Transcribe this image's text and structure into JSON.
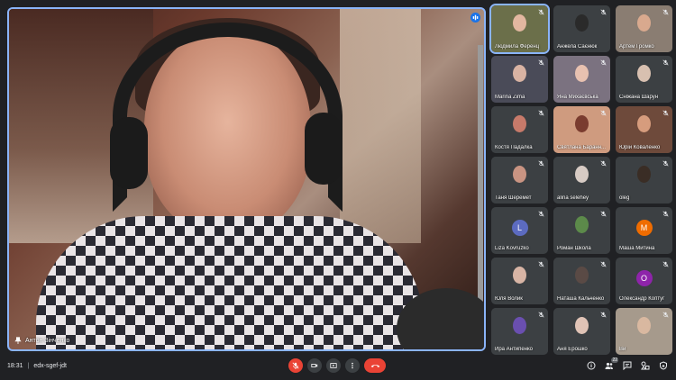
{
  "meeting": {
    "time": "18:31",
    "code": "edx-sgef-jdt"
  },
  "main_speaker": {
    "name": "Антон Зінченко"
  },
  "participants": [
    {
      "name": "Людмила Ференц",
      "type": "video",
      "bg": "#6b6f4a",
      "face": "#e2b7a0",
      "highlight": true
    },
    {
      "name": "Анжела Саєнюк",
      "type": "video",
      "bg": "#3c4043",
      "face": "#2a2a2a"
    },
    {
      "name": "Артем Громко",
      "type": "video",
      "bg": "#8a7d72",
      "face": "#d9a98e"
    },
    {
      "name": "Marina Zima",
      "type": "video",
      "bg": "#4a4b58",
      "face": "#d9b3a3"
    },
    {
      "name": "Яна Михаєвська",
      "type": "video",
      "bg": "#7b7280",
      "face": "#e8c1b0"
    },
    {
      "name": "Сніжана Шарун",
      "type": "video",
      "bg": "#3c4043",
      "face": "#d8c0b0"
    },
    {
      "name": "Костя Падалка",
      "type": "video",
      "bg": "#3c4043",
      "face": "#c77a6a"
    },
    {
      "name": "Святлана Баранн...",
      "type": "video",
      "bg": "#cf9b7f",
      "face": "#7a3c2f"
    },
    {
      "name": "Юрій Коваленко",
      "type": "video",
      "bg": "#6e4a3b",
      "face": "#d69c7d"
    },
    {
      "name": "Таня Шеремет",
      "type": "video",
      "bg": "#3c4043",
      "face": "#c99482"
    },
    {
      "name": "alina selehey",
      "type": "video",
      "bg": "#3c4043",
      "face": "#d7cbc4"
    },
    {
      "name": "oleg",
      "type": "video",
      "bg": "#3c4043",
      "face": "#3a2d25"
    },
    {
      "name": "Liza Kovruzko",
      "type": "avatar",
      "letter": "L",
      "avatar_color": "#5c6bc0"
    },
    {
      "name": "Роман Школа",
      "type": "video",
      "bg": "#3c4043",
      "face": "#5c8a4a"
    },
    {
      "name": "Маша Митина",
      "type": "avatar",
      "letter": "M",
      "avatar_color": "#ef6c00"
    },
    {
      "name": "Юля Волик",
      "type": "video",
      "bg": "#3c4043",
      "face": "#d8b5a5"
    },
    {
      "name": "Наташа Кальченко",
      "type": "video",
      "bg": "#3c4043",
      "face": "#5a4a45"
    },
    {
      "name": "Олександр Коптуг",
      "type": "avatar",
      "letter": "О",
      "avatar_color": "#8e24aa"
    },
    {
      "name": "Ира Антипенко",
      "type": "video",
      "bg": "#3c4043",
      "face": "#6a4fb0"
    },
    {
      "name": "Аня Ерошко",
      "type": "video",
      "bg": "#3c4043",
      "face": "#e0c3b6"
    },
    {
      "name": "Ви",
      "type": "video",
      "bg": "#a69a8c",
      "face": "#d9b8a0"
    }
  ],
  "toolbar": {
    "participants_count": "22"
  },
  "colors": {
    "accent": "#8ab4f8",
    "danger": "#ea4335",
    "surface": "#3c4043",
    "background": "#202124"
  }
}
